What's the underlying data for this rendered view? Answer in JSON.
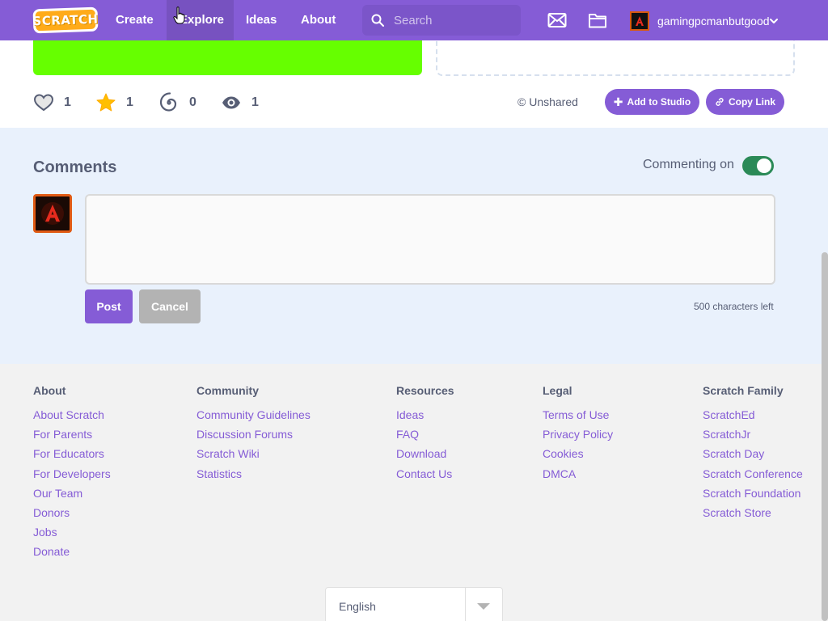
{
  "nav": {
    "logo": "SCRATCH",
    "create": "Create",
    "explore": "Explore",
    "ideas": "Ideas",
    "about": "About",
    "search_placeholder": "Search",
    "username": "gamingpcmanbutgood"
  },
  "project": {
    "stats": {
      "loves": "1",
      "favorites": "1",
      "remixes": "0",
      "views": "1"
    },
    "unshared": "© Unshared",
    "add_to_studio": "Add to Studio",
    "copy_link": "Copy Link"
  },
  "comments": {
    "title": "Comments",
    "commenting_label": "Commenting on",
    "commenting_on": true,
    "input_value": "",
    "post": "Post",
    "cancel": "Cancel",
    "chars_left": "500 characters left"
  },
  "footer": {
    "columns": [
      {
        "title": "About",
        "links": [
          "About Scratch",
          "For Parents",
          "For Educators",
          "For Developers",
          "Our Team",
          "Donors",
          "Jobs",
          "Donate"
        ]
      },
      {
        "title": "Community",
        "links": [
          "Community Guidelines",
          "Discussion Forums",
          "Scratch Wiki",
          "Statistics"
        ]
      },
      {
        "title": "Resources",
        "links": [
          "Ideas",
          "FAQ",
          "Download",
          "Contact Us"
        ]
      },
      {
        "title": "Legal",
        "links": [
          "Terms of Use",
          "Privacy Policy",
          "Cookies",
          "DMCA"
        ]
      },
      {
        "title": "Scratch Family",
        "links": [
          "ScratchEd",
          "ScratchJr",
          "Scratch Day",
          "Scratch Conference",
          "Scratch Foundation",
          "Scratch Store"
        ]
      }
    ],
    "language": "English"
  },
  "colors": {
    "brand": "#855cd6",
    "toggle_on": "#2b8a57",
    "stage": "#66ff00",
    "star": "#ffbf00"
  }
}
